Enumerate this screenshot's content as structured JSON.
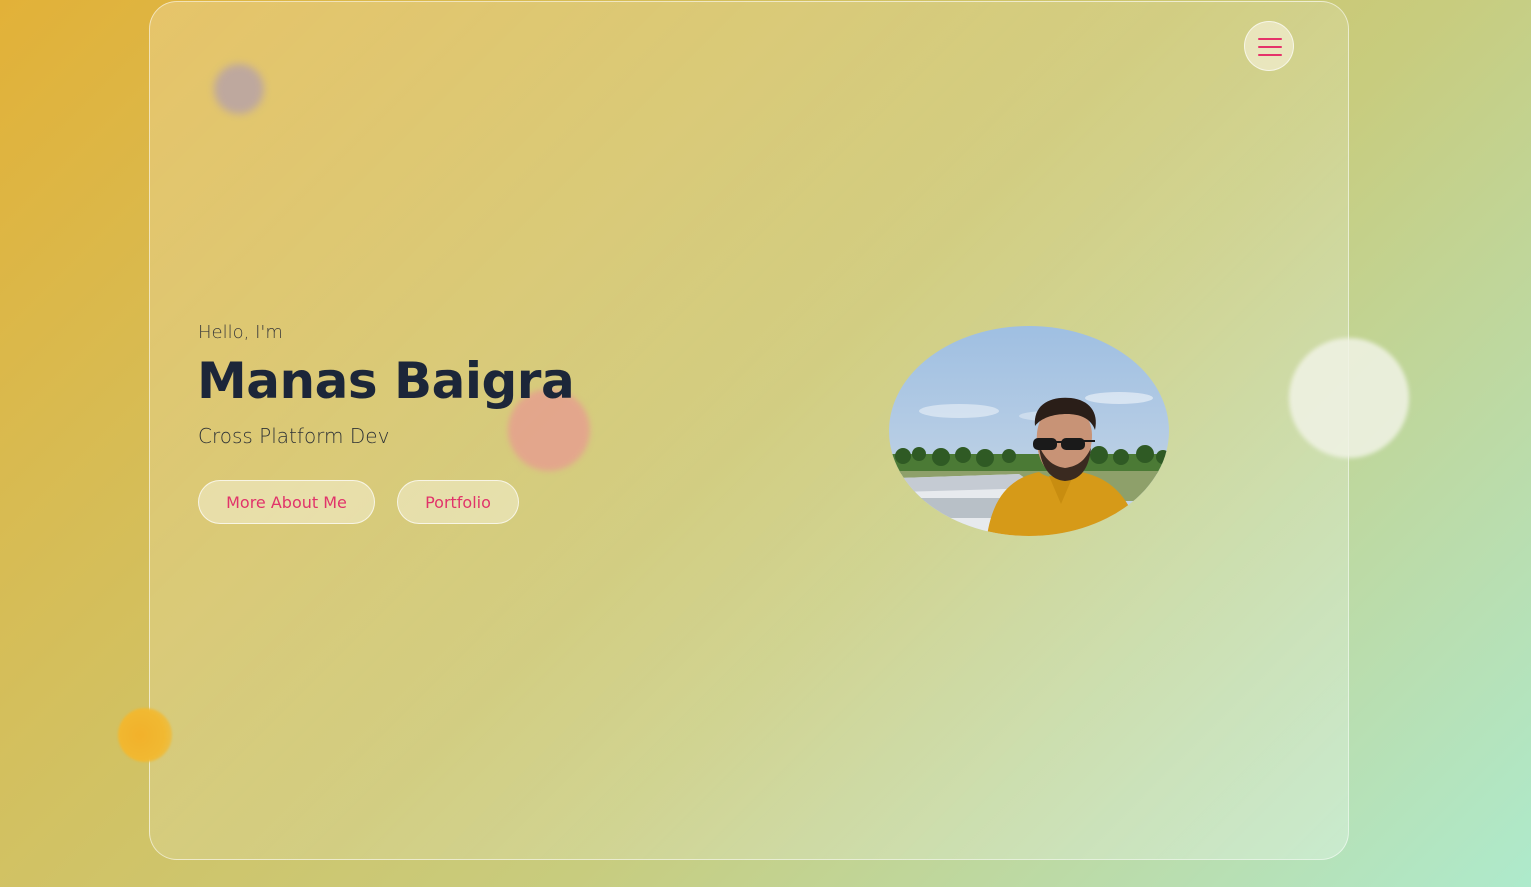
{
  "hero": {
    "greeting": "Hello, I'm",
    "name": "Manas Baigra",
    "role": "Cross Platform Dev",
    "buttons": {
      "about": "More About Me",
      "portfolio": "Portfolio"
    }
  },
  "header": {
    "menu_icon": "hamburger-menu-icon"
  },
  "colors": {
    "accent": "#e5336a",
    "heading": "#1c2639",
    "background_start": "#e2b138",
    "background_end": "#aeeacc"
  }
}
